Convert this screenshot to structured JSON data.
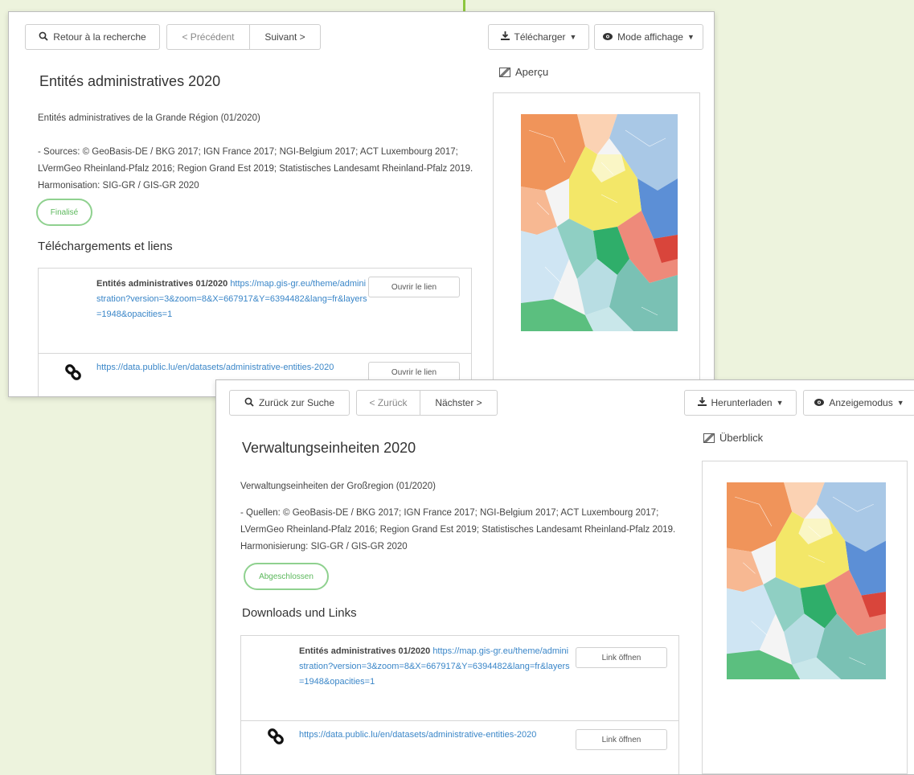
{
  "colors": {
    "background": "#edf3dd",
    "accent_green": "#8cc63f",
    "link": "#3a86c8",
    "badge": "#5cb85c"
  },
  "fr": {
    "toolbar": {
      "back_search": "Retour à la recherche",
      "previous": "< Précédent",
      "next": "Suivant >",
      "download": "Télécharger",
      "display_mode": "Mode affichage"
    },
    "title": "Entités administratives 2020",
    "subtitle": "Entités administratives de la Grande Région (01/2020)",
    "sources": "- Sources: © GeoBasis-DE / BKG 2017; IGN France 2017; NGI-Belgium 2017; ACT Luxembourg 2017; LVermGeo Rheinland-Pfalz 2016; Region Grand Est 2019; Statistisches Landesamt Rheinland-Pfalz 2019. Harmonisation: SIG-GR / GIS-GR 2020",
    "status": "Finalisé",
    "section_links": "Téléchargements et liens",
    "links": [
      {
        "name": "Entités administratives 01/2020",
        "url": "https://map.gis-gr.eu/theme/administration?version=3&zoom=8&X=667917&Y=6394482&lang=fr&layers=1948&opacities=1",
        "button": "Ouvrir le lien"
      },
      {
        "name": "",
        "url": "https://data.public.lu/en/datasets/administrative-entities-2020",
        "button": "Ouvrir le lien"
      }
    ],
    "preview_label": "Aperçu"
  },
  "de": {
    "toolbar": {
      "back_search": "Zurück zur Suche",
      "previous": "< Zurück",
      "next": "Nächster >",
      "download": "Herunterladen",
      "display_mode": "Anzeigemodus"
    },
    "title": "Verwaltungseinheiten 2020",
    "subtitle": "Verwaltungseinheiten der Großregion (01/2020)",
    "sources": "- Quellen: © GeoBasis-DE / BKG 2017; IGN France 2017; NGI-Belgium 2017; ACT Luxembourg 2017; LVermGeo Rheinland-Pfalz 2016; Region Grand Est 2019; Statistisches Landesamt Rheinland-Pfalz 2019. Harmonisierung: SIG-GR / GIS-GR 2020",
    "status": "Abgeschlossen",
    "section_links": "Downloads und Links",
    "links": [
      {
        "name": "Entités administratives 01/2020",
        "url": "https://map.gis-gr.eu/theme/administration?version=3&zoom=8&X=667917&Y=6394482&lang=fr&layers=1948&opacities=1",
        "button": "Link öffnen"
      },
      {
        "name": "",
        "url": "https://data.public.lu/en/datasets/administrative-entities-2020",
        "button": "Link öffnen"
      }
    ],
    "preview_label": "Überblick"
  }
}
